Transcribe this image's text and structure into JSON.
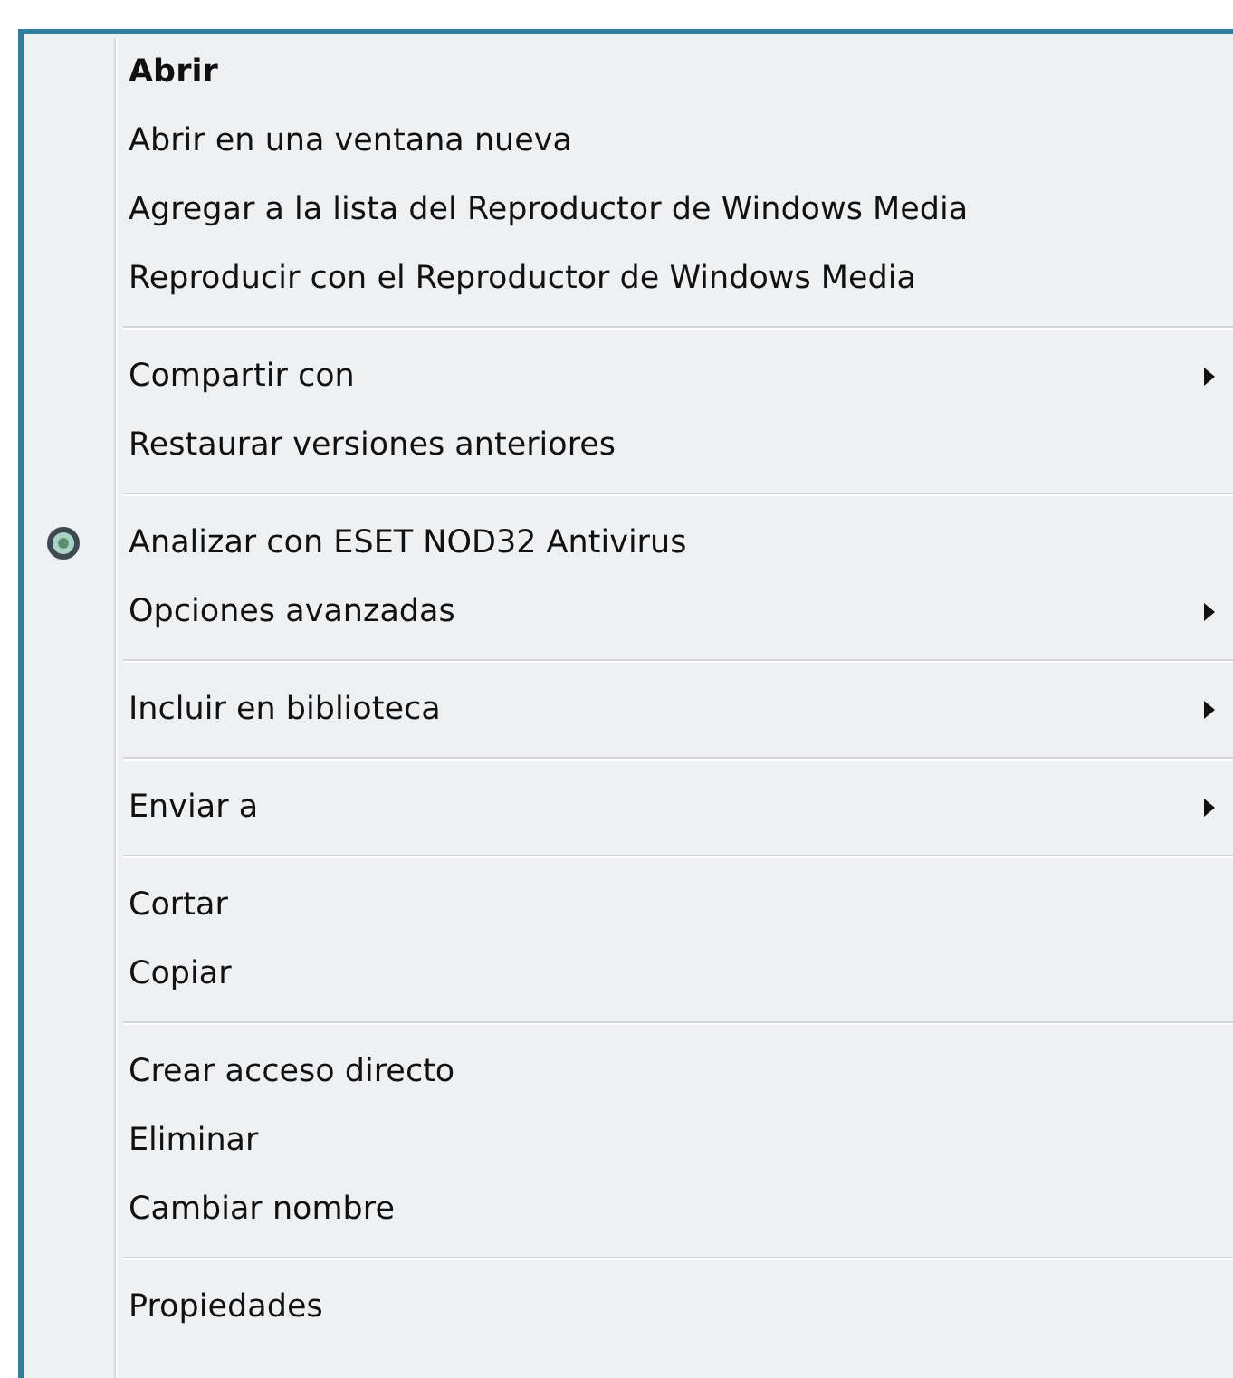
{
  "context_menu": {
    "groups": [
      {
        "items": [
          {
            "label": "Abrir",
            "kind": "text",
            "default": true,
            "submenu": false
          },
          {
            "label": "Abrir en una ventana nueva",
            "kind": "text",
            "default": false,
            "submenu": false
          },
          {
            "label": "Agregar a la lista del Reproductor de Windows Media",
            "kind": "text",
            "default": false,
            "submenu": false
          },
          {
            "label": "Reproducir con el Reproductor de Windows Media",
            "kind": "text",
            "default": false,
            "submenu": false
          }
        ]
      },
      {
        "items": [
          {
            "label": "Compartir con",
            "kind": "text",
            "default": false,
            "submenu": true
          },
          {
            "label": "Restaurar versiones anteriores",
            "kind": "text",
            "default": false,
            "submenu": false
          }
        ]
      },
      {
        "items": [
          {
            "label": "Analizar con ESET NOD32 Antivirus",
            "kind": "icon",
            "default": false,
            "submenu": false
          },
          {
            "label": "Opciones avanzadas",
            "kind": "text",
            "default": false,
            "submenu": true
          }
        ]
      },
      {
        "items": [
          {
            "label": "Incluir en biblioteca",
            "kind": "text",
            "default": false,
            "submenu": true
          }
        ]
      },
      {
        "items": [
          {
            "label": "Enviar a",
            "kind": "text",
            "default": false,
            "submenu": true
          }
        ]
      },
      {
        "items": [
          {
            "label": "Cortar",
            "kind": "text",
            "default": false,
            "submenu": false
          },
          {
            "label": "Copiar",
            "kind": "text",
            "default": false,
            "submenu": false
          }
        ]
      },
      {
        "items": [
          {
            "label": "Crear acceso directo",
            "kind": "text",
            "default": false,
            "submenu": false
          },
          {
            "label": "Eliminar",
            "kind": "text",
            "default": false,
            "submenu": false
          },
          {
            "label": "Cambiar nombre",
            "kind": "text",
            "default": false,
            "submenu": false
          }
        ]
      },
      {
        "items": [
          {
            "label": "Propiedades",
            "kind": "text",
            "default": false,
            "submenu": false
          }
        ]
      }
    ]
  }
}
